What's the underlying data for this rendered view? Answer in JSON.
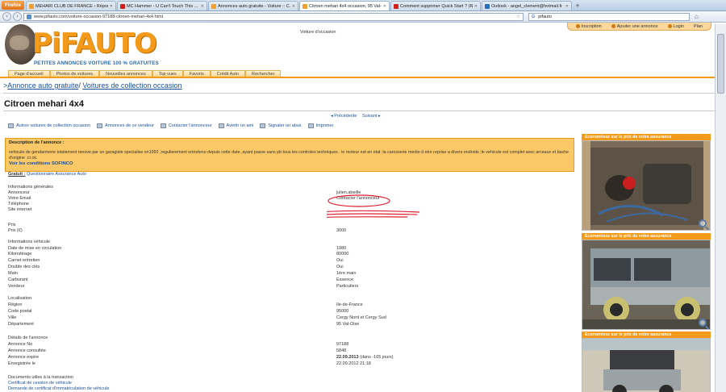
{
  "browser": {
    "menu_button": "Firefox",
    "tabs": [
      {
        "label": "MEHARI CLUB DE FRANCE › Répondre",
        "color": "#f0a030",
        "active": false
      },
      {
        "label": "MC Hammer - U Can't Touch This ...",
        "color": "#d02020",
        "active": false
      },
      {
        "label": "Annonces auto gratuite - Voiture :: C...",
        "color": "#f0a030",
        "active": false
      },
      {
        "label": "Citroen mehari 4x4 occasion, 95 Val-...",
        "color": "#f0a030",
        "active": true
      },
      {
        "label": "Comment supprimer Quick Start ? (R...",
        "color": "#d02020",
        "active": false
      },
      {
        "label": "Outlook - angel_clement@hotmail.fr",
        "color": "#2a6cc0",
        "active": false
      }
    ],
    "url": "www.pifauto.com/voiture-occasion-97188-citroen-mehari-4x4.html",
    "search_value": "pifauto",
    "search_engine": "G"
  },
  "site": {
    "logo": "PiFAUTO",
    "tagline": "PETITES ANNONCES VOITURE 100 % GRATUITES",
    "header_label": "Voiture d'occasion",
    "top_links": [
      "Inscription",
      "Ajouter une annonce",
      "Login",
      "Plan"
    ],
    "menu": [
      "Page d'accueil",
      "Photos de voitures",
      "Nouvelles annonces",
      "Top vues",
      "Favoris",
      "Crédit Auto",
      "Rechercher"
    ],
    "breadcrumb": {
      "prefix": ">",
      "first": "Annonce auto gratuite",
      "sep": "/",
      "second": "Voitures de collection occasion"
    }
  },
  "listing": {
    "title": "Citroen mehari 4x4",
    "prev": "Précédente",
    "next": "Suivant",
    "actions": [
      "Autres voitures de collection occasion",
      "Annonces de ce vendeur",
      "Contacter l'annonceur",
      "Avertir un ami",
      "Signaler un abus",
      "Imprimer"
    ],
    "desc_heading": "Description de l'annonce :",
    "desc_text": "vehicule de gendarmerie totalement renove par un garagiste specialise en1992 ,regulierement entretenu depuis cette date ,ayant passe sans pb tous les controles techniques . le moteur est en etat ;la carosserie merite d etre reprise a divers endroits ;le vehicule est complet avec arceaux et bache d'origine .ct ok.",
    "sofinco": "Voir les conditions SOFINCO",
    "gratuit_label": "Gratuit :",
    "gratuit_link": "Questionnaire Assurance Auto",
    "sections": {
      "general": {
        "title": "Informations générales",
        "rows": [
          {
            "label": "Annonceur",
            "value": "julien.abeille"
          },
          {
            "label": "Votre Email",
            "value": "Contacter l'annonceur"
          },
          {
            "label": "Téléphone",
            "value": ""
          },
          {
            "label": "Site internet",
            "value": ""
          }
        ]
      },
      "prix": {
        "title": "Prix",
        "rows": [
          {
            "label": "Prix (€)",
            "value": "3000"
          }
        ]
      },
      "vehicule": {
        "title": "Informations véhicule",
        "rows": [
          {
            "label": "Date de mise en circulation",
            "value": "1980"
          },
          {
            "label": "Kilométrage",
            "value": "80000"
          },
          {
            "label": "Carnet entretien",
            "value": "Oui"
          },
          {
            "label": "Double des clés",
            "value": "Oui"
          },
          {
            "label": "Main",
            "value": "1ère main"
          },
          {
            "label": "Carburant",
            "value": "Essence"
          },
          {
            "label": "Vendeur",
            "value": "Particuliers"
          }
        ]
      },
      "localisation": {
        "title": "Localisation",
        "rows": [
          {
            "label": "Région",
            "value": "Ile-de-France"
          },
          {
            "label": "Code postal",
            "value": "95000"
          },
          {
            "label": "Ville",
            "value": "Cergy Nord et Cergy Sud"
          },
          {
            "label": "Département",
            "value": "95 Val-Oise"
          }
        ]
      },
      "details": {
        "title": "Détails de l'annonce",
        "rows": [
          {
            "label": "Annonce No",
            "value": "97188"
          },
          {
            "label": "Annonce consultée",
            "value": "5848"
          },
          {
            "label": "Annonce expire",
            "value": "22.09.2013",
            "extra": "(dans -165 jours)"
          },
          {
            "label": "Enregistrée le",
            "value": "22.09.2012 21:18"
          }
        ]
      },
      "documents": {
        "title": "Documents utiles à la transaction",
        "links": [
          "Certificat de cession de véhicule",
          "Demande de certificat d'immatriculation de véhicule"
        ]
      }
    }
  },
  "sidebar": {
    "banner": "Economisez sur le prix de votre assurance"
  }
}
